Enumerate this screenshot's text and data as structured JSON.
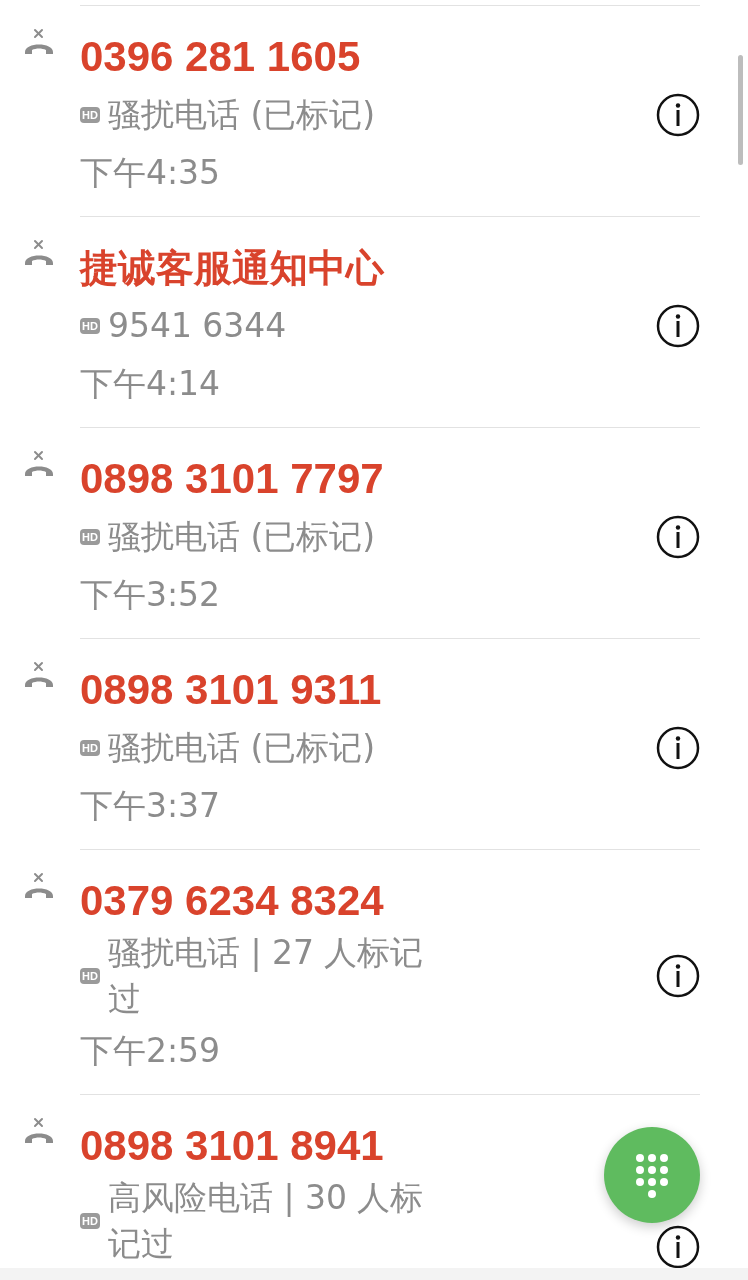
{
  "calls": [
    {
      "name": "0396 281 1605",
      "badge": "HD",
      "detail": "骚扰电话 (已标记)",
      "time": "下午4:35"
    },
    {
      "name": "捷诚客服通知中心",
      "badge": "HD",
      "detail": "9541 6344",
      "time": "下午4:14"
    },
    {
      "name": "0898 3101 7797",
      "badge": "HD",
      "detail": "骚扰电话 (已标记)",
      "time": "下午3:52"
    },
    {
      "name": "0898 3101 9311",
      "badge": "HD",
      "detail": "骚扰电话 (已标记)",
      "time": "下午3:37"
    },
    {
      "name": "0379 6234 8324",
      "badge": "HD",
      "detail": "骚扰电话 | 27 人标记过",
      "time": "下午2:59"
    },
    {
      "name": "0898 3101 8941",
      "badge": "HD",
      "detail": "高风险电话 | 30 人标记过"
    }
  ]
}
